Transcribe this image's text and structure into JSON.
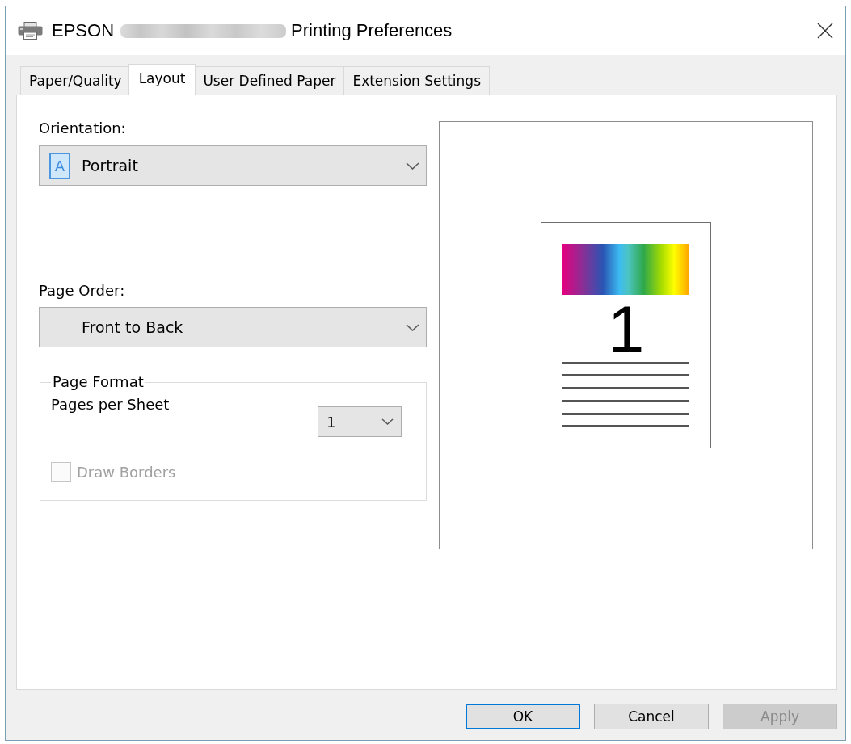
{
  "window": {
    "title_start": "EPSON",
    "title_redacted": true,
    "title_end": "Printing Preferences"
  },
  "tabs": [
    {
      "label": "Paper/Quality",
      "selected": false
    },
    {
      "label": "Layout",
      "selected": true
    },
    {
      "label": "User Defined Paper",
      "selected": false
    },
    {
      "label": "Extension Settings",
      "selected": false
    }
  ],
  "orientation": {
    "label": "Orientation:",
    "icon_letter": "A",
    "value": "Portrait"
  },
  "page_order": {
    "label": "Page Order:",
    "value": "Front to Back"
  },
  "page_format": {
    "title": "Page Format",
    "pages_per_sheet": {
      "label": "Pages per Sheet",
      "value": "1"
    },
    "draw_borders": {
      "label": "Draw Borders",
      "checked": false,
      "disabled": true
    }
  },
  "preview": {
    "page_number": "1"
  },
  "buttons": [
    {
      "label": "OK",
      "default": true,
      "disabled": false
    },
    {
      "label": "Cancel",
      "default": false,
      "disabled": false
    },
    {
      "label": "Apply",
      "default": false,
      "disabled": true
    }
  ]
}
